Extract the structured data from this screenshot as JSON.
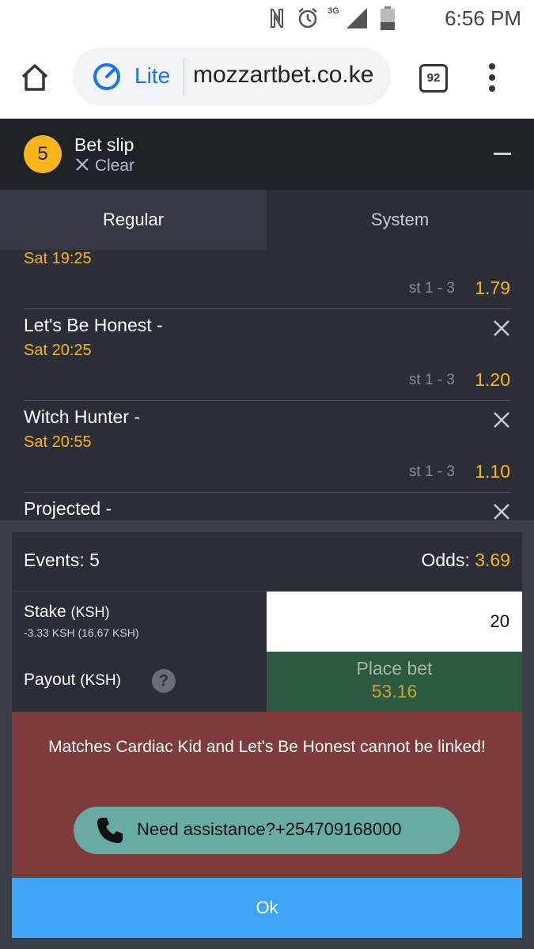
{
  "status_bar": {
    "network": "3G",
    "time": "6:56 PM",
    "icons": [
      "nfc-icon",
      "alarm-icon",
      "signal-icon",
      "battery-icon"
    ]
  },
  "browser": {
    "lite_label": "Lite",
    "url": "mozzartbet.co.ke",
    "tab_count": "92",
    "icons": [
      "home-icon",
      "lite-speed-icon",
      "tabs-icon",
      "menu-dots-icon"
    ]
  },
  "bet_slip": {
    "count": "5",
    "title": "Bet slip",
    "clear_label": "Clear",
    "icons": [
      "close-icon",
      "minus-icon"
    ]
  },
  "tabs": {
    "regular": "Regular",
    "system": "System"
  },
  "events": [
    {
      "name": "",
      "time": "Sat 19:25",
      "market": "st 1 - 3",
      "odds": "1.79"
    },
    {
      "name": "Let's Be Honest -",
      "time": "Sat 20:25",
      "market": "st 1 - 3",
      "odds": "1.20"
    },
    {
      "name": "Witch Hunter -",
      "time": "Sat 20:55",
      "market": "st 1 - 3",
      "odds": "1.10"
    },
    {
      "name": "Projected -",
      "time": "",
      "market": "",
      "odds": ""
    }
  ],
  "summary": {
    "events_label": "Events:",
    "events_count": "5",
    "odds_label": "Odds:",
    "odds_value": "3.69",
    "stake_label": "Stake",
    "stake_unit": "(KSH)",
    "stake_sub": "-3.33 KSH (16.67 KSH)",
    "stake_value": "20",
    "payout_label": "Payout",
    "payout_unit": "(KSH)",
    "help_glyph": "?",
    "place_bet_label": "Place bet",
    "place_bet_amount": "53.16"
  },
  "error": {
    "message": "Matches Cardiac Kid and Let's Be Honest cannot be linked!",
    "assist_label": "Need assistance?+254709168000",
    "ok_label": "Ok"
  },
  "colors": {
    "accent_yellow": "#f8b41b",
    "dark_bg": "#2b2e36",
    "error_bg": "#7f3b3a",
    "ok_blue": "#3da5f5",
    "assist_teal": "#67aba4",
    "place_bet_green": "#2b5a40"
  }
}
